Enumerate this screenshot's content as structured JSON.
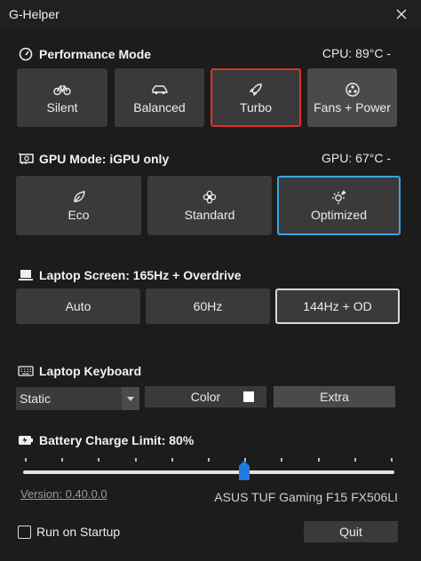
{
  "window": {
    "title": "G-Helper"
  },
  "performance": {
    "title": "Performance Mode",
    "temp": "CPU: 89°C -",
    "modes": [
      {
        "label": "Silent",
        "icon": "bike-icon"
      },
      {
        "label": "Balanced",
        "icon": "car-icon"
      },
      {
        "label": "Turbo",
        "icon": "rocket-icon",
        "selected": true
      },
      {
        "label": "Fans + Power",
        "icon": "fan-icon"
      }
    ]
  },
  "gpu": {
    "title": "GPU Mode: iGPU only",
    "temp": "GPU: 67°C -",
    "modes": [
      {
        "label": "Eco",
        "icon": "leaf-icon"
      },
      {
        "label": "Standard",
        "icon": "flower-icon"
      },
      {
        "label": "Optimized",
        "icon": "sparkle-gear-icon",
        "selected": true
      }
    ]
  },
  "screen": {
    "title": "Laptop Screen: 165Hz + Overdrive",
    "modes": [
      {
        "label": "Auto"
      },
      {
        "label": "60Hz"
      },
      {
        "label": "144Hz + OD",
        "selected": true
      }
    ]
  },
  "keyboard": {
    "title": "Laptop Keyboard",
    "mode_value": "Static",
    "color_label": "Color",
    "extra_label": "Extra",
    "swatch_color": "#ffffff"
  },
  "battery": {
    "title": "Battery Charge Limit: 80%",
    "limit_percent": 80
  },
  "footer": {
    "version": "Version:  0.40.0.0",
    "model": "ASUS TUF Gaming F15 FX506LI",
    "run_on_startup": "Run on Startup",
    "run_on_startup_checked": false,
    "quit": "Quit"
  },
  "colors": {
    "background": "#1c1c1c",
    "button": "#3a3a3a",
    "turbo_border": "#e0302f",
    "optimized_border": "#3aa4e6"
  }
}
